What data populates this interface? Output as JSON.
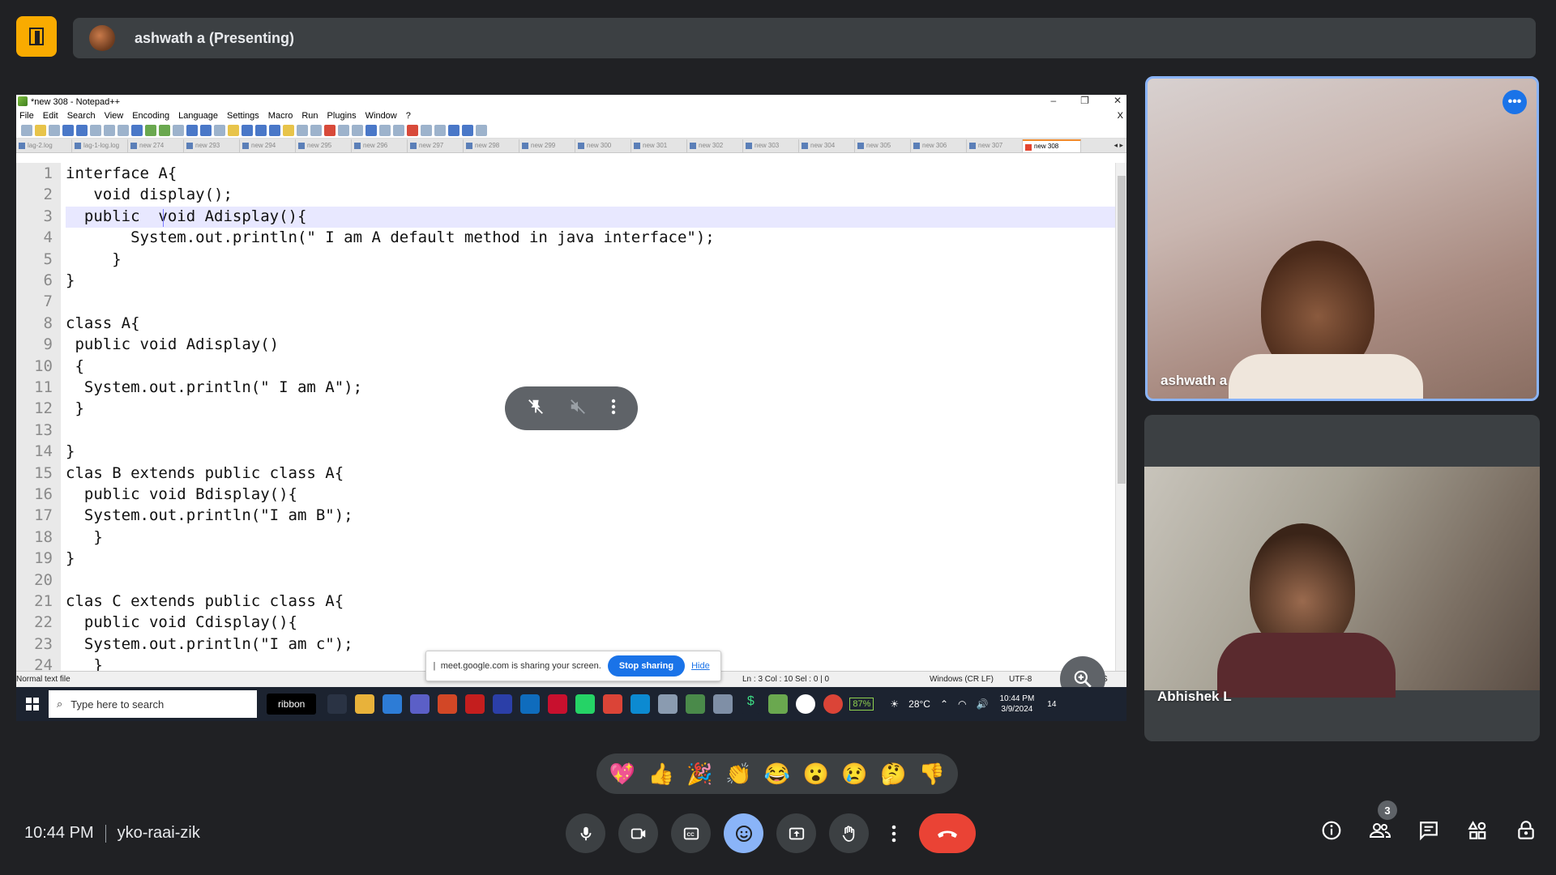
{
  "meet": {
    "presenter_label": "ashwath a (Presenting)",
    "time": "10:44 PM",
    "meeting_code": "yko-raai-zik",
    "participants_count": "3",
    "colors": {
      "background": "#202124",
      "bar": "#3c4043",
      "accent": "#8ab4f8",
      "end_call": "#ea4335",
      "logo": "#f9ab00"
    }
  },
  "notepad": {
    "title": "*new 308 - Notepad++",
    "menu": [
      "File",
      "Edit",
      "Search",
      "View",
      "Encoding",
      "Language",
      "Settings",
      "Macro",
      "Run",
      "Plugins",
      "Window",
      "?"
    ],
    "menu_close": "X",
    "tabs": [
      "lag-2.log",
      "lag-1-log.log",
      "new 274",
      "new 293",
      "new 294",
      "new 295",
      "new 296",
      "new 297",
      "new 298",
      "new 299",
      "new 300",
      "new 301",
      "new 302",
      "new 303",
      "new 304",
      "new 305",
      "new 306",
      "new 307",
      "new 308"
    ],
    "active_tab": "new 308",
    "code_lines": [
      "interface A{",
      "   void display();",
      "  public  void Adisplay(){",
      "       System.out.println(\" I am A default method in java interface\");",
      "     }",
      "}",
      "",
      "class A{",
      " public void Adisplay()",
      " {",
      "  System.out.println(\" I am A\");",
      " }",
      "",
      "}",
      "clas B extends public class A{",
      "  public void Bdisplay(){",
      "  System.out.println(\"I am B\");",
      "   }",
      "}",
      "",
      "clas C extends public class A{",
      "  public void Cdisplay(){",
      "  System.out.println(\"I am c\");",
      "   }"
    ],
    "status": {
      "file_type": "Normal text file",
      "position": "Ln : 3    Col : 10    Sel : 0 | 0",
      "eol": "Windows (CR LF)",
      "encoding": "UTF-8",
      "mode": "INS"
    }
  },
  "share_notice": {
    "text": "meet.google.com is sharing your screen.",
    "stop_label": "Stop sharing",
    "hide_label": "Hide"
  },
  "taskbar": {
    "search_placeholder": "Type here to search",
    "ribbon_label": "ribbon",
    "battery": "87%",
    "temperature": "28°C",
    "clock_time": "10:44 PM",
    "clock_date": "3/9/2024",
    "notifications": "14"
  },
  "participants": [
    {
      "name": "ashwath a"
    },
    {
      "name": "Abhishek L"
    }
  ],
  "reactions": [
    "💖",
    "👍",
    "🎉",
    "👏",
    "😂",
    "😮",
    "😢",
    "🤔",
    "👎"
  ]
}
